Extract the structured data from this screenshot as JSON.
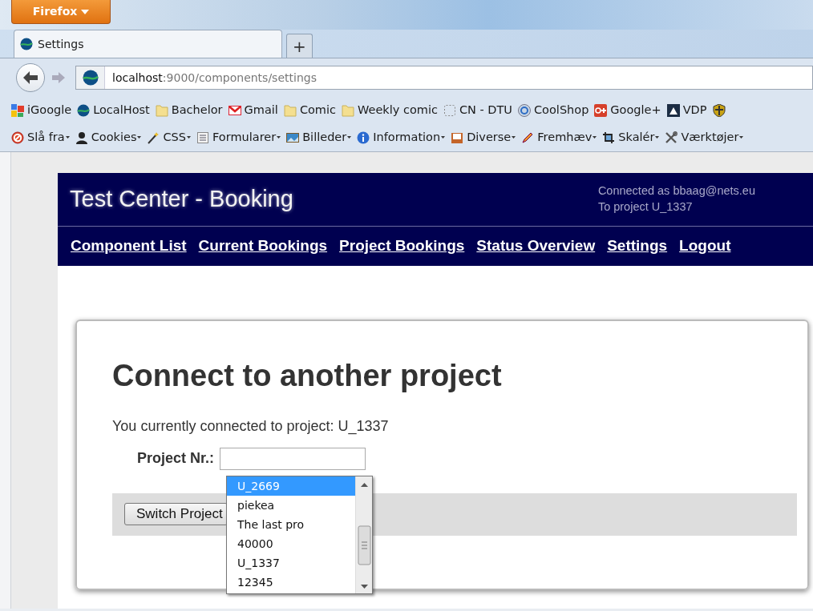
{
  "browser": {
    "menu_button": "Firefox",
    "tabs": [
      {
        "title": "Settings",
        "selected": true
      }
    ],
    "new_tab": "+",
    "url": {
      "host": "localhost",
      "path": ":9000/components/settings"
    },
    "bookmarks": [
      {
        "label": "iGoogle",
        "kind": "tiles"
      },
      {
        "label": "LocalHost",
        "kind": "globe"
      },
      {
        "label": "Bachelor",
        "kind": "folder"
      },
      {
        "label": "Gmail",
        "kind": "mail"
      },
      {
        "label": "Comic",
        "kind": "folder"
      },
      {
        "label": "Weekly comic",
        "kind": "folder"
      },
      {
        "label": "CN - DTU",
        "kind": "dashed"
      },
      {
        "label": "CoolShop",
        "kind": "disc"
      },
      {
        "label": "Google+",
        "kind": "plus"
      },
      {
        "label": "VDP",
        "kind": "prism"
      },
      {
        "kind": "shield"
      }
    ],
    "addon_toolbar": [
      {
        "label": "Slå fra",
        "kind": "forbidden"
      },
      {
        "label": "Cookies",
        "kind": "person"
      },
      {
        "label": "CSS",
        "kind": "wand"
      },
      {
        "label": "Formularer",
        "kind": "form"
      },
      {
        "label": "Billeder",
        "kind": "image"
      },
      {
        "label": "Information",
        "kind": "info"
      },
      {
        "label": "Diverse",
        "kind": "tray"
      },
      {
        "label": "Fremhæv",
        "kind": "pencil"
      },
      {
        "label": "Skalér",
        "kind": "crop"
      },
      {
        "label": "Værktøjer",
        "kind": "tools"
      }
    ]
  },
  "app": {
    "title": "Test Center - Booking",
    "user_line": "Connected as bbaag@nets.eu",
    "project_line": "To project U_1337",
    "nav": [
      "Component List",
      "Current Bookings",
      "Project Bookings",
      "Status Overview",
      "Settings",
      "Logout"
    ]
  },
  "form": {
    "heading": "Connect to another project",
    "status": "You currently connected to project: U_1337",
    "field_label": "Project Nr.:",
    "submit": "Switch Project",
    "suggestions": [
      {
        "label": "U_2669",
        "selected": true
      },
      {
        "label": "piekea",
        "selected": false
      },
      {
        "label": "The last pro",
        "selected": false
      },
      {
        "label": "40000",
        "selected": false
      },
      {
        "label": "U_1337",
        "selected": false
      },
      {
        "label": "12345",
        "selected": false
      }
    ]
  }
}
